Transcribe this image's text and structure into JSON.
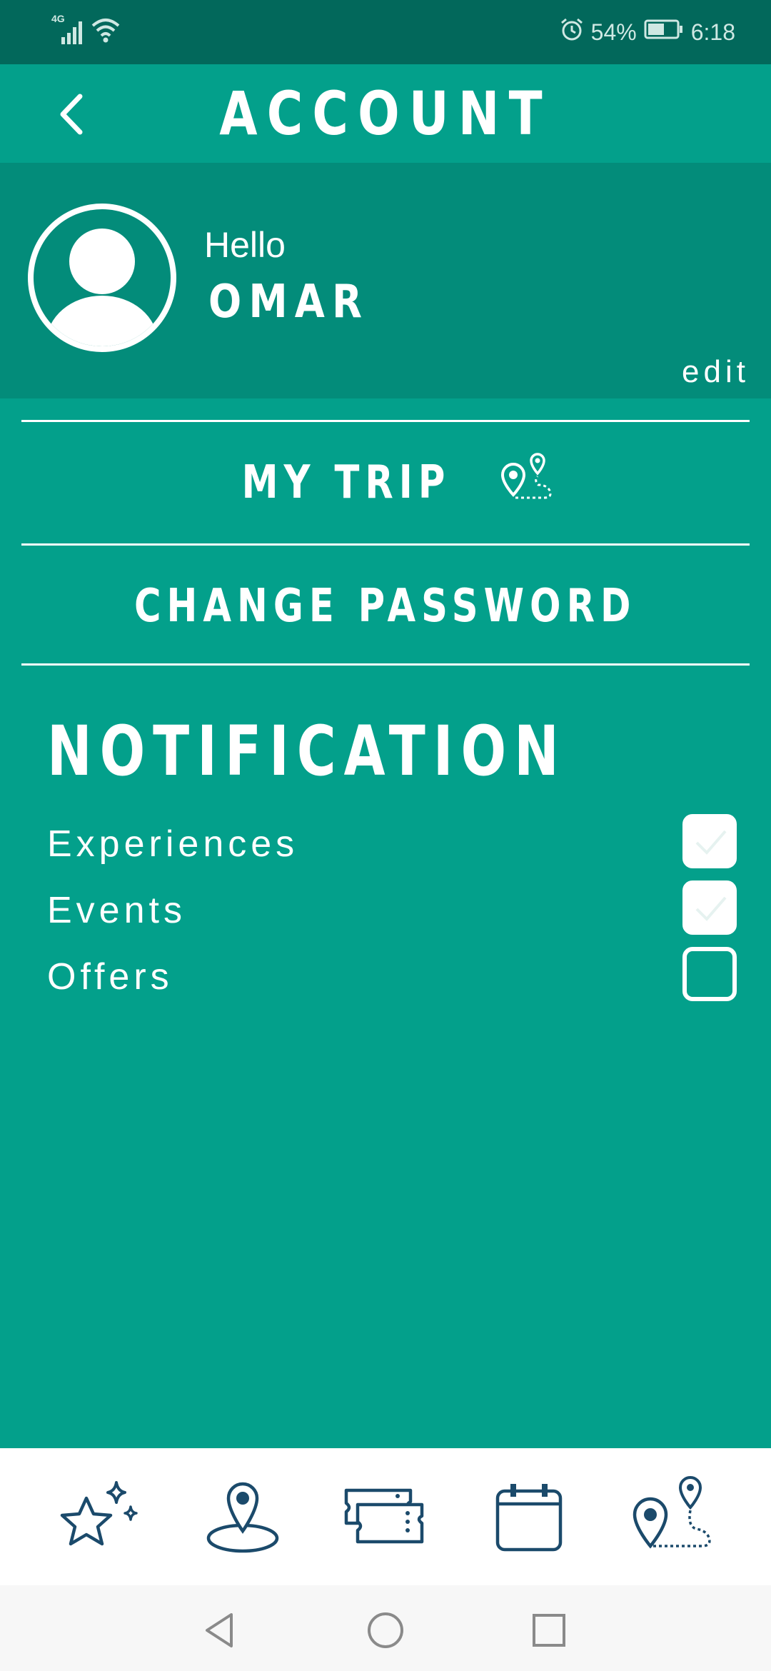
{
  "status_bar": {
    "network": "4G",
    "battery_percent": "54%",
    "time": "6:18",
    "icons": [
      "signal-icon",
      "wifi-icon",
      "alarm-icon",
      "battery-icon"
    ]
  },
  "header": {
    "title": "ACCOUNT",
    "back_icon": "chevron-left-icon"
  },
  "profile": {
    "greeting": "Hello",
    "name": "OMAR",
    "edit_label": "edit",
    "avatar_icon": "user-avatar-icon"
  },
  "menu": {
    "my_trip": "MY TRIP",
    "my_trip_icon": "route-pins-icon",
    "change_password": "CHANGE PASSWORD"
  },
  "notification": {
    "title": "NOTIFICATION",
    "items": [
      {
        "label": "Experiences",
        "checked": true
      },
      {
        "label": "Events",
        "checked": true
      },
      {
        "label": "Offers",
        "checked": false
      }
    ]
  },
  "tab_bar": {
    "tabs": [
      {
        "icon": "sparkle-star-icon"
      },
      {
        "icon": "location-pin-icon"
      },
      {
        "icon": "tickets-icon"
      },
      {
        "icon": "calendar-icon"
      },
      {
        "icon": "route-pins-icon"
      }
    ]
  },
  "system_nav": {
    "buttons": [
      "back-triangle-icon",
      "home-circle-icon",
      "recents-square-icon"
    ]
  },
  "colors": {
    "primary": "#03A08B",
    "profile_bg": "#038C7A",
    "status_bar_bg": "#02685B",
    "tab_icon": "#1B4A6B",
    "text": "#FFFFFF"
  }
}
